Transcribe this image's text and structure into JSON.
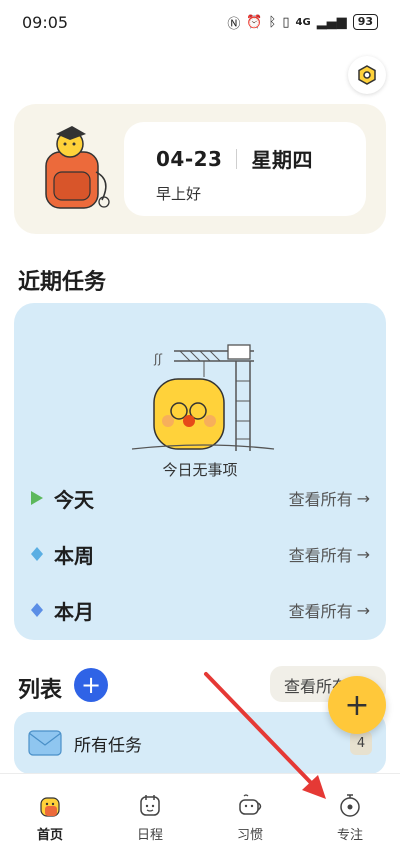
{
  "status_bar": {
    "time": "09:05",
    "network": "4G",
    "battery": "93"
  },
  "header": {
    "date": "04-23",
    "weekday": "星期四",
    "greeting": "早上好"
  },
  "tasks_section": {
    "title": "近期任务",
    "empty_text": "今日无事项",
    "periods": [
      {
        "label": "今天",
        "view_all": "查看所有",
        "icon_color": "#5cb85c"
      },
      {
        "label": "本周",
        "view_all": "查看所有",
        "icon_color": "#5aaee3"
      },
      {
        "label": "本月",
        "view_all": "查看所有",
        "icon_color": "#5b8ee6"
      }
    ]
  },
  "list_section": {
    "title": "列表",
    "view_all": "查看所有",
    "items": [
      {
        "label": "所有任务",
        "count": "4"
      }
    ]
  },
  "bottom_nav": {
    "items": [
      {
        "label": "首页",
        "active": true
      },
      {
        "label": "日程",
        "active": false
      },
      {
        "label": "习惯",
        "active": false
      },
      {
        "label": "专注",
        "active": false
      }
    ]
  },
  "icons": {
    "settings": "settings-icon",
    "add": "plus-icon",
    "fab": "plus-icon",
    "all_tasks": "envelope-icon"
  },
  "colors": {
    "accent_blue": "#2f63e6",
    "fab_yellow": "#ffc83a",
    "panel_blue": "#d6ebf8",
    "hero_bg": "#f7f4ea",
    "annotation_red": "#e53935"
  }
}
